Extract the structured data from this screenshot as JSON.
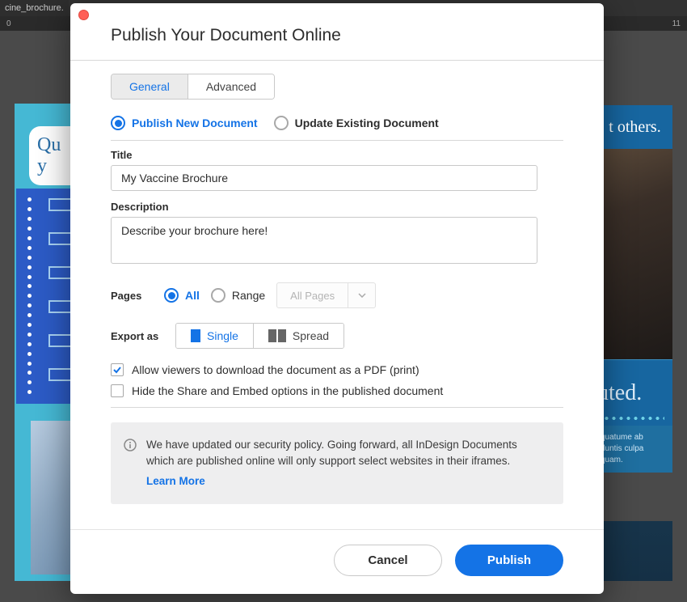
{
  "app": {
    "tab_fragment": "cine_brochure.",
    "ruler_left": "0",
    "ruler_right": "11"
  },
  "bg_left": {
    "qu_line1": "Qu",
    "qu_line2": "y"
  },
  "bg_right": {
    "top_text": "t others.",
    "uted": "uted.",
    "caption_1": "quatume ab",
    "caption_2": "duntis culpa",
    "caption_3": "quam."
  },
  "dialog": {
    "title": "Publish Your Document Online",
    "tabs": {
      "general": "General",
      "advanced": "Advanced"
    },
    "mode": {
      "publish_new": "Publish New Document",
      "update_existing": "Update Existing Document"
    },
    "title_field": {
      "label": "Title",
      "value": "My Vaccine Brochure"
    },
    "description_field": {
      "label": "Description",
      "value": "Describe your brochure here!"
    },
    "pages": {
      "label": "Pages",
      "all": "All",
      "range": "Range",
      "select_placeholder": "All Pages"
    },
    "export": {
      "label": "Export as",
      "single": "Single",
      "spread": "Spread"
    },
    "options": {
      "allow_download": "Allow viewers to download the document as a PDF (print)",
      "hide_share": "Hide the Share and Embed options in the published document"
    },
    "info": {
      "text": "We have updated our security policy. Going forward, all InDesign Documents which are published online will only support select websites in their iframes.",
      "learn_more": "Learn More"
    },
    "footer": {
      "cancel": "Cancel",
      "publish": "Publish"
    }
  }
}
